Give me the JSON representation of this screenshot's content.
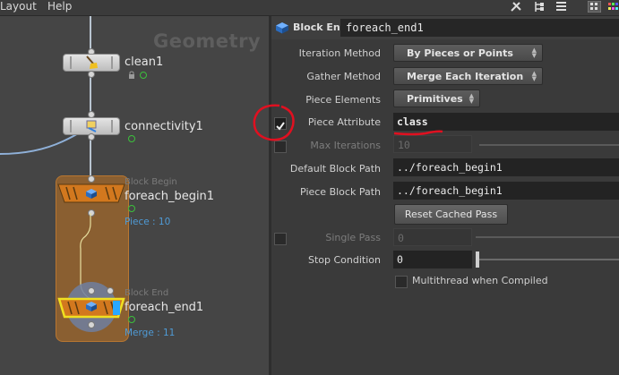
{
  "menubar": {
    "items": [
      "Layout",
      "Help"
    ]
  },
  "network": {
    "title": "Geometry",
    "nodes": {
      "clean": {
        "name": "clean1"
      },
      "connectivity": {
        "name": "connectivity1"
      },
      "begin": {
        "type_label": "Block Begin",
        "name": "foreach_begin1",
        "info": "Piece : 10"
      },
      "end": {
        "type_label": "Block End",
        "name": "foreach_end1",
        "info": "Merge : 11"
      }
    }
  },
  "params": {
    "header": {
      "type": "Block End",
      "name": "foreach_end1"
    },
    "iteration_method": {
      "label": "Iteration Method",
      "value": "By Pieces or Points"
    },
    "gather_method": {
      "label": "Gather Method",
      "value": "Merge Each Iteration"
    },
    "piece_elements": {
      "label": "Piece Elements",
      "value": "Primitives"
    },
    "piece_attribute": {
      "label": "Piece Attribute",
      "value": "class",
      "checked": true
    },
    "max_iterations": {
      "label": "Max Iterations",
      "value": "10"
    },
    "default_block_path": {
      "label": "Default Block Path",
      "value": "../foreach_begin1"
    },
    "piece_block_path": {
      "label": "Piece Block Path",
      "value": "../foreach_begin1"
    },
    "reset_button": {
      "label": "Reset Cached Pass"
    },
    "single_pass": {
      "label": "Single Pass",
      "value": "0"
    },
    "stop_condition": {
      "label": "Stop Condition",
      "value": "0"
    },
    "multithread": {
      "label": "Multithread when Compiled"
    }
  },
  "colors": {
    "annotation": "#e01020",
    "node_info": "#4f9bd6",
    "block_region": "#8e6130",
    "selected_outline": "#f0e020"
  }
}
